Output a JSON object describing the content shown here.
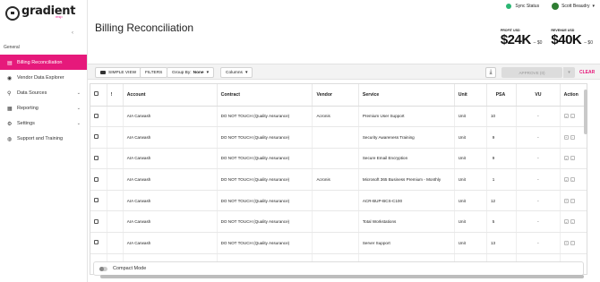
{
  "logo": {
    "text": "gradient",
    "sub": "msp"
  },
  "topbar": {
    "sync_label": "Sync Status",
    "user_name": "Scott Beaudry"
  },
  "sidebar": {
    "section": "General",
    "items": [
      {
        "label": "Billing Reconciliation",
        "icon": "billing-icon",
        "active": true
      },
      {
        "label": "Vendor Data Explorer",
        "icon": "explorer-icon"
      },
      {
        "label": "Data Sources",
        "icon": "data-sources-icon",
        "chevron": true
      },
      {
        "label": "Reporting",
        "icon": "reporting-icon",
        "chevron": true
      },
      {
        "label": "Settings",
        "icon": "settings-icon",
        "chevron": true
      },
      {
        "label": "Support and Training",
        "icon": "support-icon"
      }
    ]
  },
  "page": {
    "title": "Billing Reconciliation"
  },
  "metrics": {
    "profit": {
      "label": "PROFIT USD",
      "value": "$24K",
      "delta": "– $0"
    },
    "revenue": {
      "label": "REVENUE USD",
      "value": "$40K",
      "delta": "– $0"
    }
  },
  "toolbar": {
    "simple_view": "SIMPLE VIEW",
    "filters": "FILTERS",
    "group_by_label": "Group By:",
    "group_by_value": "None",
    "columns": "Columns",
    "approve": "APPROVE (0)",
    "clear": "CLEAR"
  },
  "table": {
    "columns": [
      "",
      "!",
      "Account",
      "Contract",
      "Vendor",
      "Service",
      "Unit",
      "PSA",
      "VU",
      "Action"
    ],
    "rows": [
      {
        "account": "AIA Carwash",
        "contract": "DO NOT TOUCH (Quality Assurance)",
        "vendor": "Acronis",
        "service": "Premium User Support",
        "unit": "Unit",
        "psa": "10",
        "vu": "-"
      },
      {
        "account": "AIA Carwash",
        "contract": "DO NOT TOUCH (Quality Assurance)",
        "vendor": "",
        "service": "Security Awareness Training",
        "unit": "Unit",
        "psa": "9",
        "vu": "-"
      },
      {
        "account": "AIA Carwash",
        "contract": "DO NOT TOUCH (Quality Assurance)",
        "vendor": "",
        "service": "Secure Email Encryption",
        "unit": "Unit",
        "psa": "9",
        "vu": "-"
      },
      {
        "account": "AIA Carwash",
        "contract": "DO NOT TOUCH (Quality Assurance)",
        "vendor": "Acronis",
        "service": "Microsoft 365 Business Premium - Monthly",
        "unit": "Unit",
        "psa": "1",
        "vu": "-"
      },
      {
        "account": "AIA Carwash",
        "contract": "DO NOT TOUCH (Quality Assurance)",
        "vendor": "",
        "service": "ACR-BUP-BCS-C100",
        "unit": "Unit",
        "psa": "12",
        "vu": "-"
      },
      {
        "account": "AIA Carwash",
        "contract": "DO NOT TOUCH (Quality Assurance)",
        "vendor": "",
        "service": "Total Workstations",
        "unit": "Unit",
        "psa": "5",
        "vu": "-"
      },
      {
        "account": "AIA Carwash",
        "contract": "DO NOT TOUCH (Quality Assurance)",
        "vendor": "",
        "service": "Server Support",
        "unit": "Unit",
        "psa": "13",
        "vu": "-"
      },
      {
        "account": "",
        "contract": "",
        "vendor": "",
        "service": "",
        "unit": "",
        "psa": "",
        "vu": ""
      }
    ]
  },
  "footer": {
    "compact_mode": "Compact Mode"
  },
  "colors": {
    "accent": "#e6197b",
    "sync_ok": "#2bb673"
  }
}
